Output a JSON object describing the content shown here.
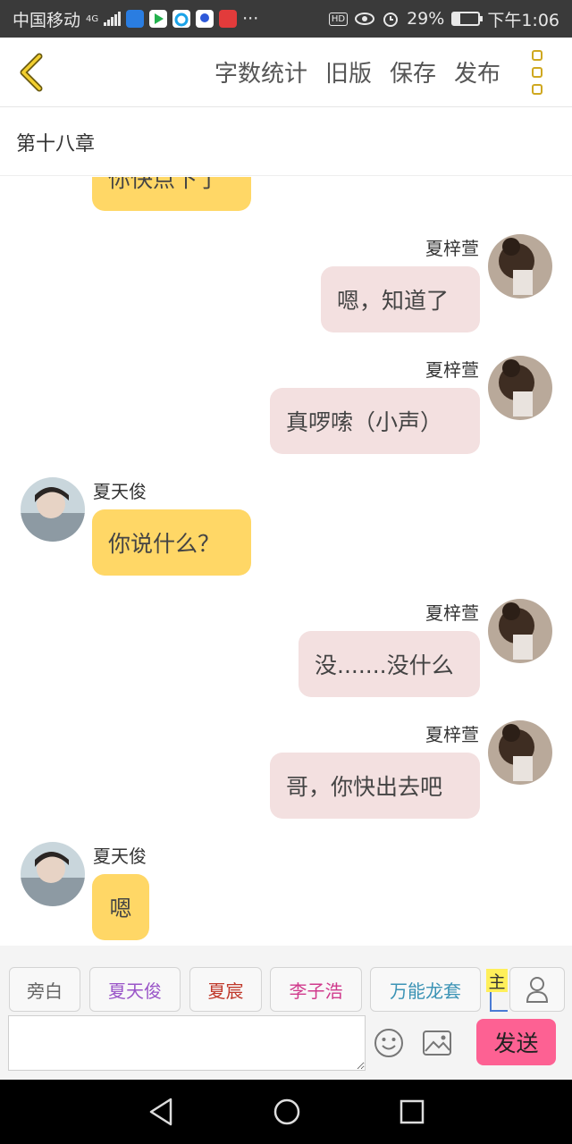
{
  "status_bar": {
    "carrier": "中国移动",
    "network": "4G",
    "hd": "HD",
    "battery": "29%",
    "time": "下午1:06",
    "more": "···",
    "app_icons": [
      "shield-app-icon",
      "video-play-app-icon",
      "browser-app-icon",
      "baidu-app-icon",
      "reader-app-icon"
    ],
    "battery_level": 0.29
  },
  "header": {
    "back_icon": "chevron-left-icon",
    "actions": [
      "字数统计",
      "旧版",
      "保存",
      "发布"
    ],
    "menu_icon": "more-vertical-icon"
  },
  "chapter_title": "第十八章",
  "colors": {
    "left_bubble": "#ffd766",
    "right_bubble": "#f3e0e0",
    "send_button": "#fd6193",
    "accent_gold": "#cfa820"
  },
  "messages": [
    {
      "side": "left",
      "name": "",
      "text": "你快点下了",
      "partial": true
    },
    {
      "side": "right",
      "name": "夏梓萱",
      "text": "嗯，知道了"
    },
    {
      "side": "right",
      "name": "夏梓萱",
      "text": "真啰嗦（小声）"
    },
    {
      "side": "left",
      "name": "夏天俊",
      "text": "你说什么？"
    },
    {
      "side": "right",
      "name": "夏梓萱",
      "text": "没.......没什么"
    },
    {
      "side": "right",
      "name": "夏梓萱",
      "text": "哥，你快出去吧"
    },
    {
      "side": "left",
      "name": "夏天俊",
      "text": "嗯"
    }
  ],
  "characters": [
    {
      "label": "旁白",
      "color": "#666666"
    },
    {
      "label": "夏天俊",
      "color": "#9a55c8"
    },
    {
      "label": "夏宸",
      "color": "#c0392b"
    },
    {
      "label": "李子浩",
      "color": "#d03a8c"
    },
    {
      "label": "万能龙套",
      "color": "#3b93b5"
    }
  ],
  "protagonist_tag": "主",
  "input": {
    "value": "",
    "placeholder": ""
  },
  "tools": {
    "emoji_icon": "emoji-icon",
    "image_icon": "image-icon",
    "person_icon": "person-icon"
  },
  "send_label": "发送",
  "nav_icons": [
    "back-triangle-icon",
    "home-circle-icon",
    "recents-square-icon"
  ]
}
